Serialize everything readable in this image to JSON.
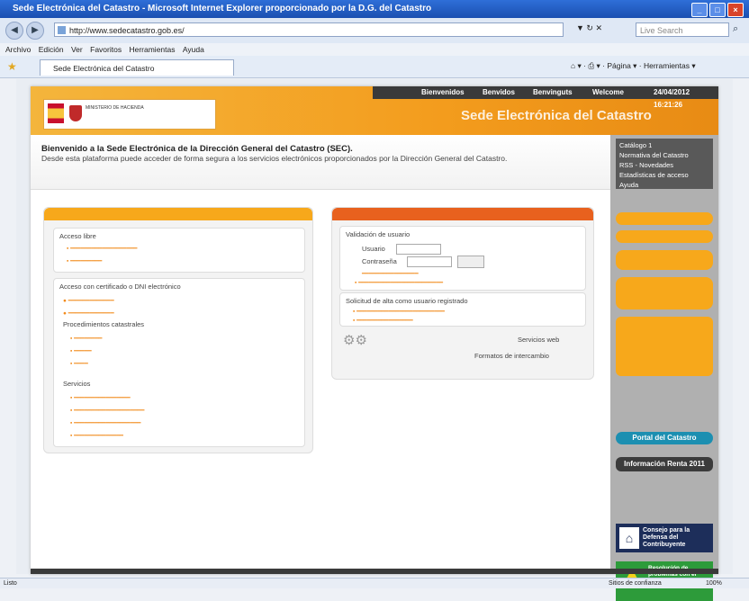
{
  "window": {
    "title": "Sede Electrónica del Catastro - Microsoft Internet Explorer proporcionado por la D.G. del Catastro"
  },
  "address": {
    "url": "http://www.sedecatastro.gob.es/",
    "search_placeholder": "Live Search"
  },
  "menu": [
    "Archivo",
    "Edición",
    "Ver",
    "Favoritos",
    "Herramientas",
    "Ayuda"
  ],
  "tab": {
    "label": "Sede Electrónica del Catastro"
  },
  "toolbar": {
    "page": "Página",
    "tools": "Herramientas"
  },
  "topnav": {
    "items": [
      "Bienvenidos",
      "Benvidos",
      "Benvinguts",
      "Welcome"
    ],
    "datetime": "24/04/2012 16:21:26"
  },
  "header": {
    "site_title": "Sede Electrónica del Catastro"
  },
  "welcome": {
    "heading": "Bienvenido a la Sede Electrónica de la Dirección General del Catastro (SEC).",
    "subtext": "Desde esta plataforma puede acceder de forma segura a los servicios electrónicos proporcionados por la Dirección General del Catastro."
  },
  "sidebar": {
    "links": [
      "Catálogo 1",
      "Normativa del Catastro",
      "RSS - Novedades",
      "Estadísticas de acceso",
      "Ayuda"
    ],
    "portal": "Portal del Catastro",
    "info": "Información Renta 2011",
    "consejo": "Consejo para la Defensa del Contribuyente",
    "resolucion": "Resolución de problemas con el certificado de DNIE"
  },
  "left_panel": {
    "acceso_libre": "Acceso libre",
    "acceso_cert": "Acceso con certificado o DNI electrónico",
    "procedimientos": "Procedimientos catastrales",
    "servicios": "Servicios"
  },
  "right_panel": {
    "validacion": "Validación de usuario",
    "usuario": "Usuario",
    "contrasena": "Contraseña",
    "solicitud": "Solicitud de alta como usuario registrado",
    "servicios_web": "Servicios web",
    "formatos": "Formatos de intercambio"
  },
  "status": {
    "zone": "Sitios de confianza",
    "zoom": "100%"
  }
}
